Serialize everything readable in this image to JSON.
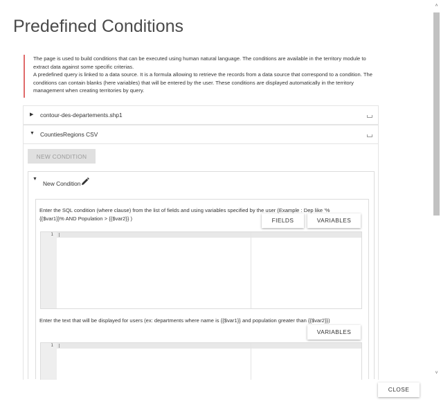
{
  "page": {
    "title": "Predefined Conditions",
    "info": [
      "The page is used to build conditions that can be executed using human natural language. The conditions are available in the territory module to extract data against some specific criterias.",
      "A predefined query is linked to a data source. It is a formula allowing to retrieve the records from a data source that correspond to a condition. The conditions can contain blanks (here variables) that will be entered by the user. These conditions are displayed automatically in the territory management when creating territories by query."
    ]
  },
  "layers": [
    {
      "name": "contour-des-departements.shp1",
      "expanded": false,
      "caret": "▶"
    },
    {
      "name": "CountiesRegions CSV",
      "expanded": true,
      "caret": "▼"
    }
  ],
  "actions": {
    "new_condition": "NEW CONDITION",
    "close": "CLOSE"
  },
  "condition": {
    "caret": "▼",
    "title": "New Condition",
    "sql_description": "Enter the SQL condition (where clause) from the list of fields and using variables specified by the user (Example : Dep like '%{{$var1}}% AND Population > {{$var2}} )",
    "fields_button": "FIELDS",
    "variables_button": "VARIABLES",
    "sql_editor_line": "1",
    "text_description": "Enter the text that will be displayed for users (ex: departments where name is {{$var1}} and population greater than {{$var2}})",
    "text_variables_button": "VARIABLES",
    "text_editor_line": "1"
  },
  "scrollbar": {
    "up_arrow": "˄",
    "down_arrow": "˅"
  }
}
